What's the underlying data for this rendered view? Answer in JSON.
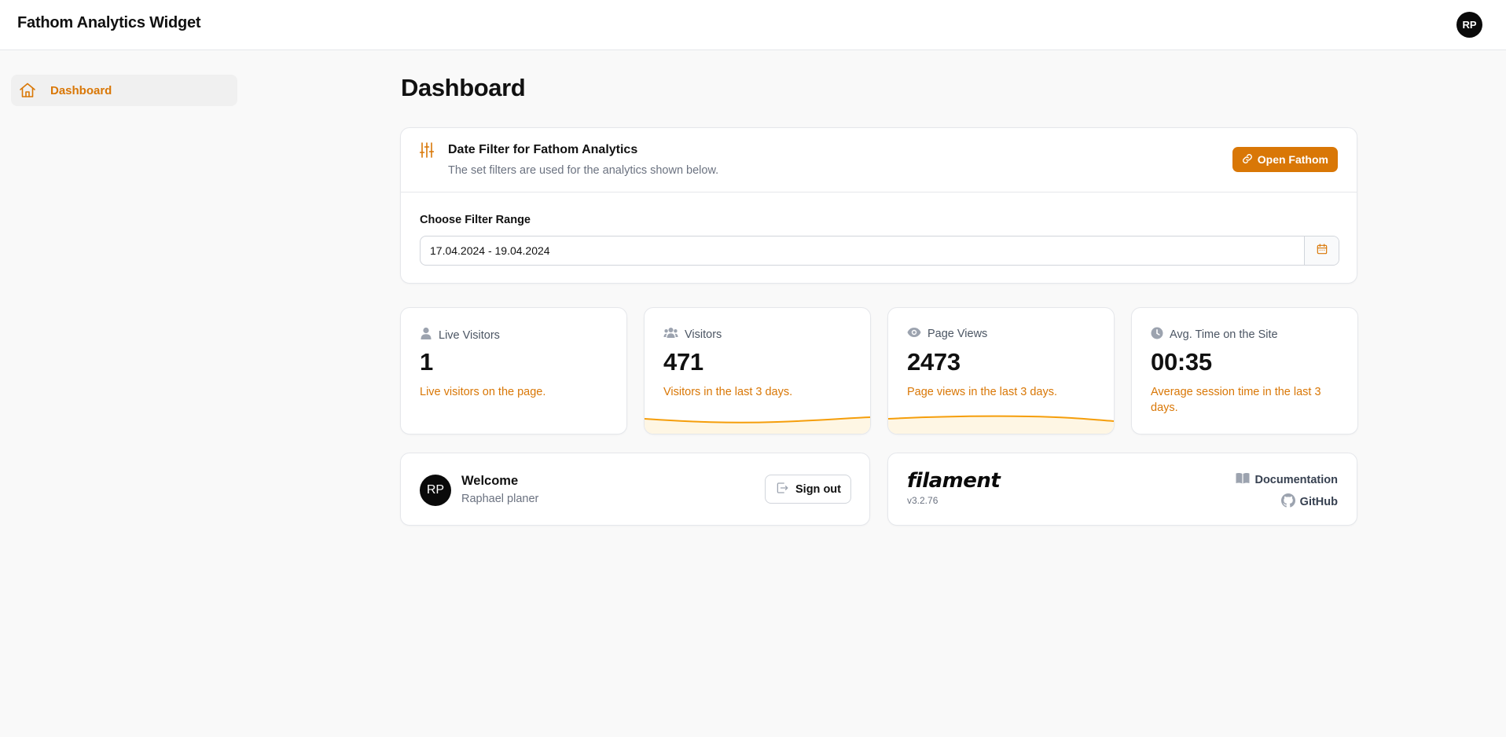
{
  "app": {
    "title": "Fathom Analytics Widget",
    "avatar_initials": "RP"
  },
  "sidebar": {
    "items": [
      {
        "label": "Dashboard",
        "icon": "home-icon",
        "active": true
      }
    ]
  },
  "page": {
    "title": "Dashboard"
  },
  "filter": {
    "title": "Date Filter for Fathom Analytics",
    "description": "The set filters are used for the analytics shown below.",
    "open_button": "Open Fathom",
    "range_label": "Choose Filter Range",
    "range_value": "17.04.2024 - 19.04.2024"
  },
  "stats": [
    {
      "label": "Live Visitors",
      "icon": "user-icon",
      "value": "1",
      "description": "Live visitors on the page.",
      "sparkline": false
    },
    {
      "label": "Visitors",
      "icon": "users-icon",
      "value": "471",
      "description": "Visitors in the last 3 days.",
      "sparkline": true
    },
    {
      "label": "Page Views",
      "icon": "eye-icon",
      "value": "2473",
      "description": "Page views in the last 3 days.",
      "sparkline": true
    },
    {
      "label": "Avg. Time on the Site",
      "icon": "clock-icon",
      "value": "00:35",
      "description": "Average session time in the last 3 days.",
      "sparkline": false
    }
  ],
  "welcome": {
    "initials": "RP",
    "title": "Welcome",
    "name": "Raphael planer",
    "sign_out": "Sign out"
  },
  "filament": {
    "logo": "filament",
    "version": "v3.2.76",
    "documentation": "Documentation",
    "github": "GitHub"
  },
  "colors": {
    "accent": "#d97706",
    "text": "#111111",
    "muted": "#6b7280",
    "border": "#e5e7eb"
  }
}
